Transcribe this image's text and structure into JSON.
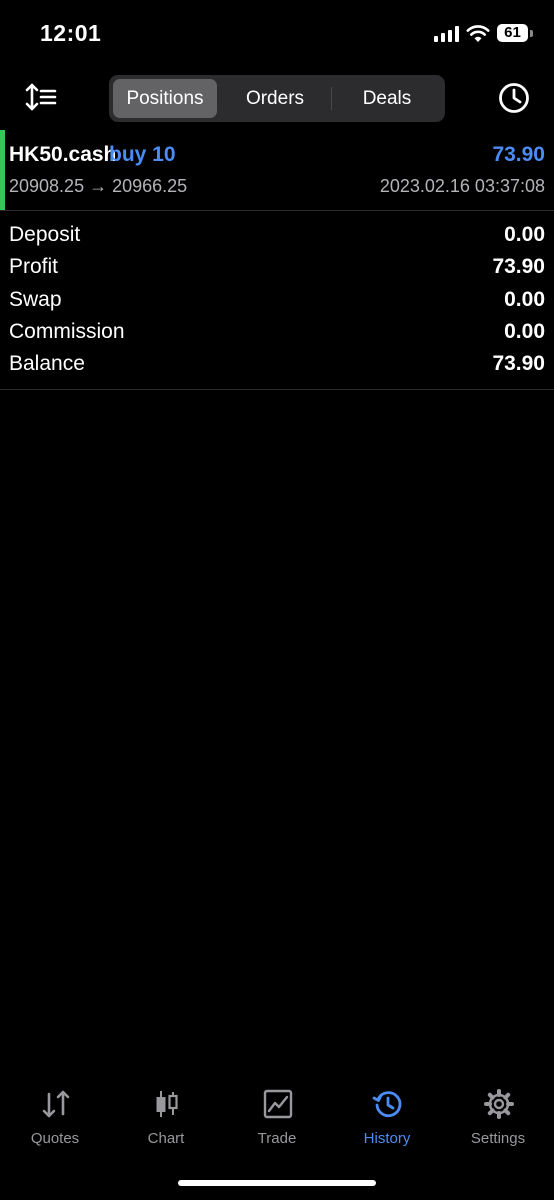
{
  "status_bar": {
    "time": "12:01",
    "battery": "61"
  },
  "segments": {
    "items": [
      "Positions",
      "Orders",
      "Deals"
    ],
    "selected": "Positions"
  },
  "deal": {
    "symbol": "HK50.cash",
    "type": "buy 10",
    "profit": "73.90",
    "prices": "20908.25 → 20966.25",
    "time": "2023.02.16 03:37:08",
    "colors": {
      "accent": "#4c8cf5",
      "buy_bar": "#34c759"
    }
  },
  "summary": [
    {
      "label": "Deposit",
      "value": "0.00"
    },
    {
      "label": "Profit",
      "value": "73.90"
    },
    {
      "label": "Swap",
      "value": "0.00"
    },
    {
      "label": "Commission",
      "value": "0.00"
    },
    {
      "label": "Balance",
      "value": "73.90"
    }
  ],
  "tabbar": {
    "items": [
      {
        "label": "Quotes",
        "icon": "quotes-arrows-icon"
      },
      {
        "label": "Chart",
        "icon": "candlestick-icon"
      },
      {
        "label": "Trade",
        "icon": "trade-chart-icon"
      },
      {
        "label": "History",
        "icon": "history-clock-icon"
      },
      {
        "label": "Settings",
        "icon": "gear-icon"
      }
    ],
    "selected": "History"
  }
}
